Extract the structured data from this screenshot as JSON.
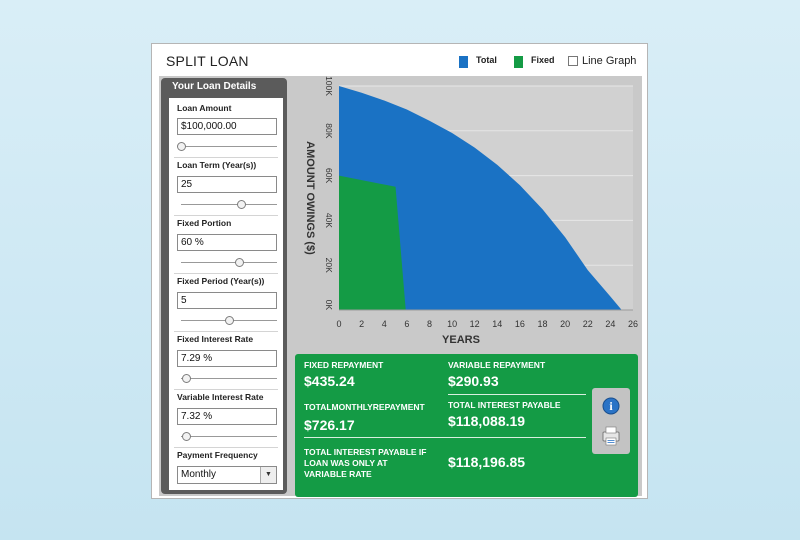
{
  "app": {
    "title": "SPLIT LOAN"
  },
  "legend": {
    "total_label": "Total",
    "fixed_label": "Fixed",
    "line_graph_label": "Line Graph",
    "line_graph_checked": false,
    "total_color": "#1a72c4",
    "fixed_color": "#149b45"
  },
  "panel": {
    "title": "Your Loan Details",
    "loan_amount": {
      "label": "Loan Amount",
      "value": "$100,000.00",
      "slider_fraction": 0.0
    },
    "loan_term": {
      "label": "Loan Term (Year(s))",
      "value": "25",
      "slider_fraction": 0.62
    },
    "fixed_portion": {
      "label": "Fixed Portion",
      "value": "60 %",
      "slider_fraction": 0.6
    },
    "fixed_period": {
      "label": "Fixed Period (Year(s))",
      "value": "5",
      "slider_fraction": 0.5
    },
    "fixed_rate": {
      "label": "Fixed Interest Rate",
      "value": "7.29 %",
      "slider_fraction": 0.05
    },
    "variable_rate": {
      "label": "Variable Interest Rate",
      "value": "7.32 %",
      "slider_fraction": 0.05
    },
    "payment_frequency": {
      "label": "Payment Frequency",
      "value": "Monthly",
      "arrow": "▼"
    }
  },
  "chart_data": {
    "type": "area",
    "xlabel": "YEARS",
    "ylabel": "AMOUNT OWINGS ($)",
    "x_ticks": [
      "0",
      "2",
      "4",
      "6",
      "8",
      "10",
      "12",
      "14",
      "16",
      "18",
      "20",
      "22",
      "24",
      "26"
    ],
    "y_ticks": [
      "0K",
      "20K",
      "40K",
      "60K",
      "80K",
      "100K"
    ],
    "xlim": [
      0,
      26
    ],
    "ylim": [
      0,
      100000
    ],
    "grid": true,
    "series": [
      {
        "name": "Total",
        "color": "#1a72c4",
        "x": [
          0,
          2,
          4,
          6,
          8,
          10,
          12,
          14,
          16,
          18,
          20,
          22,
          24,
          25
        ],
        "y": [
          100000,
          97000,
          93500,
          89500,
          84500,
          79000,
          72500,
          64800,
          55700,
          45000,
          32500,
          17800,
          6000,
          0
        ]
      },
      {
        "name": "Fixed",
        "color": "#149b45",
        "x": [
          0,
          5,
          5.9
        ],
        "y": [
          60000,
          55000,
          0
        ]
      }
    ]
  },
  "results": {
    "fixed_repayment_label": "FIXED REPAYMENT",
    "fixed_repayment_value": "$435.24",
    "variable_repayment_label": "VARIABLE REPAYMENT",
    "variable_repayment_value": "$290.93",
    "total_monthly_label": "TOTALMONTHLYREPAYMENT",
    "total_monthly_value": "$726.17",
    "total_interest_label": "TOTAL INTEREST PAYABLE",
    "total_interest_value": "$118,088.19",
    "variable_only_label_1": "TOTAL INTEREST PAYABLE IF",
    "variable_only_label_2": "LOAN WAS ONLY AT",
    "variable_only_label_3": "VARIABLE RATE",
    "variable_only_value": "$118,196.85",
    "info_glyph": "i"
  }
}
